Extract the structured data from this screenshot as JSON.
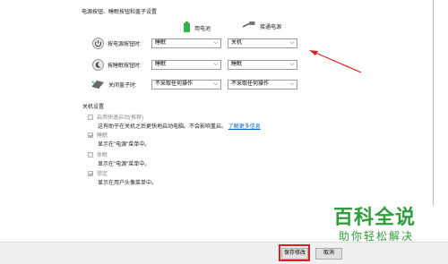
{
  "header": {
    "title": "电源按钮、睡眠按钮和盖子设置"
  },
  "columns": {
    "battery": "用电池",
    "plugged": "接通电源"
  },
  "rows": [
    {
      "label": "按电源按钮时:",
      "icon": "power-icon",
      "battery": "睡眠",
      "plugged": "关机"
    },
    {
      "label": "按睡眠按钮时:",
      "icon": "moon-icon",
      "battery": "睡眠",
      "plugged": "睡眠"
    },
    {
      "label": "关闭盖子时:",
      "icon": "laptop-icon",
      "battery": "不采取任何操作",
      "plugged": "不采取任何操作"
    }
  ],
  "shutdown": {
    "title": "关机设置",
    "fast_startup": {
      "label": "启用快速启动(推荐)",
      "desc": "这有助于在关机之后更快地启动电脑。不会影响重启。",
      "link": "了解更多信息",
      "checked": false
    },
    "sleep": {
      "label": "睡眠",
      "desc": "显示在\"电源\"菜单中。",
      "checked": true
    },
    "hibernate": {
      "label": "休眠",
      "desc": "显示在\"电源\"菜单中。",
      "checked": false
    },
    "lock": {
      "label": "锁定",
      "desc": "显示在用户头像菜单中。",
      "checked": true
    }
  },
  "buttons": {
    "save": "保存修改",
    "cancel": "取消"
  },
  "watermark": {
    "main": "百科全说",
    "sub": "助你轻松解决"
  },
  "colors": {
    "highlight": "#e02020",
    "watermark": "#2e9e3a",
    "battery_icon": "#2fb34a"
  }
}
